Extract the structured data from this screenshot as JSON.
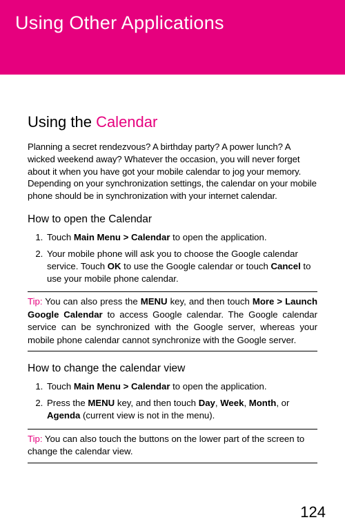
{
  "header": {
    "title": "Using Other Applications"
  },
  "section": {
    "title_prefix": "Using the ",
    "title_bold": "Calendar",
    "intro": "Planning a secret rendezvous? A birthday party? A power lunch? A wicked weekend away? Whatever the occasion, you will never forget about it when you have got your mobile calendar to jog your memory. Depending on your synchronization settings, the calendar on your mobile phone should be in synchronization with your internet calendar."
  },
  "sub1": {
    "heading": "How to open the Calendar",
    "items": [
      {
        "pre": "Touch ",
        "bold1": "Main Menu > Calendar",
        "post": " to open the application."
      },
      {
        "pre": "Your mobile phone will ask you to choose the Google calendar service. Touch ",
        "bold1": "OK",
        "mid": " to use the Google calendar or touch ",
        "bold2": "Cancel",
        "post": " to use your mobile phone calendar."
      }
    ]
  },
  "tip1": {
    "label": "Tip: ",
    "pre": " You can also press the ",
    "bold1": "MENU",
    "mid1": " key, and then touch ",
    "bold2": "More > Launch Google Calendar",
    "post": " to access Google calendar. The Google calendar service can be synchronized with the Google server, whereas your mobile phone calendar cannot synchronize with the Google server."
  },
  "sub2": {
    "heading": "How to change the calendar view",
    "items": [
      {
        "pre": "Touch ",
        "bold1": "Main Menu > Calendar",
        "post": " to open the application."
      },
      {
        "pre": "Press the ",
        "bold1": "MENU",
        "mid1": " key, and then touch ",
        "bold2": "Day",
        "sep1": ", ",
        "bold3": "Week",
        "sep2": ", ",
        "bold4": "Month",
        "sep3": ", or ",
        "bold5": "Agenda",
        "post": " (current view is not in the menu)."
      }
    ]
  },
  "tip2": {
    "label": "Tip: ",
    "text": " You can also touch the buttons on the lower part of the screen to change the calendar view."
  },
  "page": "124"
}
